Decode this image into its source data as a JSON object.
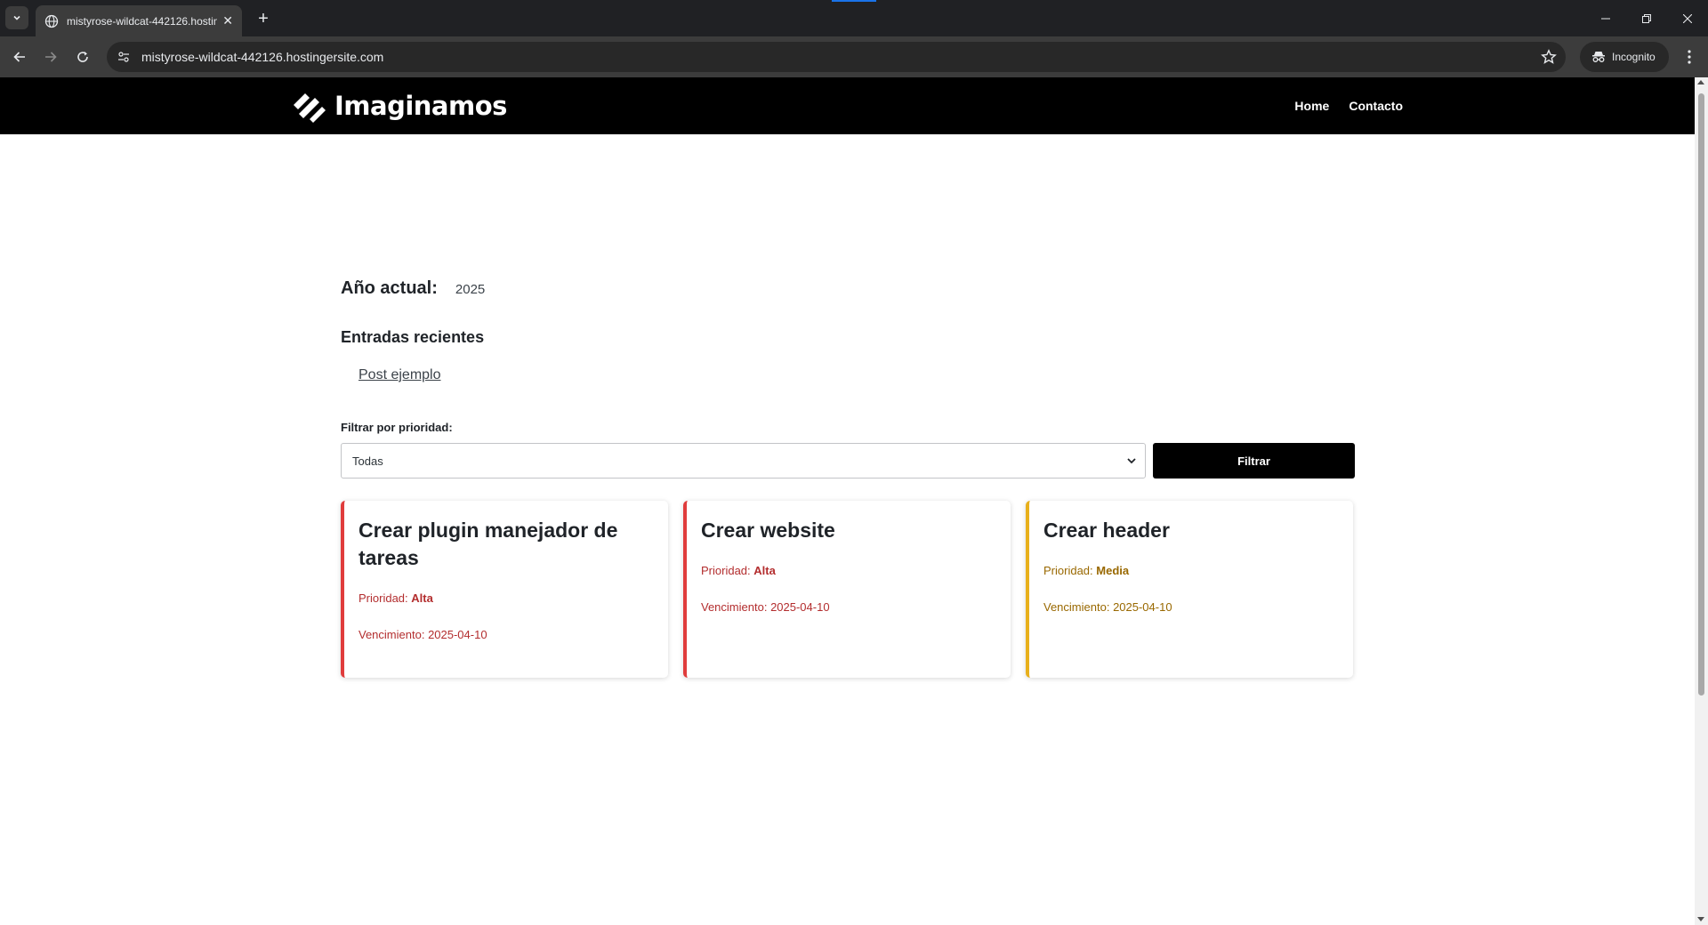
{
  "browser": {
    "tab_title": "mistyrose-wildcat-442126.hostingersite.com",
    "url": "mistyrose-wildcat-442126.hostingersite.com",
    "profile_label": "Incognito",
    "new_tab_symbol": "+",
    "tab_close_symbol": "✕"
  },
  "site": {
    "logo_text": "Imaginamos",
    "nav": [
      {
        "label": "Home"
      },
      {
        "label": "Contacto"
      }
    ]
  },
  "main": {
    "year_label": "Año actual:",
    "year_value": "2025",
    "recent_title": "Entradas recientes",
    "recent_posts": [
      {
        "label": "Post ejemplo"
      }
    ],
    "filter": {
      "label": "Filtrar por prioridad:",
      "selected": "Todas",
      "button_label": "Filtrar"
    }
  },
  "tasks": [
    {
      "title": "Crear plugin manejador de tareas",
      "priority_label": "Prioridad:",
      "priority": "Alta",
      "due_label": "Vencimiento:",
      "due_date": "2025-04-10",
      "color": "#e03c3c"
    },
    {
      "title": "Crear website",
      "priority_label": "Prioridad:",
      "priority": "Alta",
      "due_label": "Vencimiento:",
      "due_date": "2025-04-10",
      "color": "#e03c3c"
    },
    {
      "title": "Crear header",
      "priority_label": "Prioridad:",
      "priority": "Media",
      "due_label": "Vencimiento:",
      "due_date": "2025-04-10",
      "color": "#e8b01c"
    }
  ],
  "colors": {
    "header_bg": "#000000",
    "alta": "#e03c3c",
    "media": "#e8b01c",
    "browser_bg": "#202124"
  }
}
